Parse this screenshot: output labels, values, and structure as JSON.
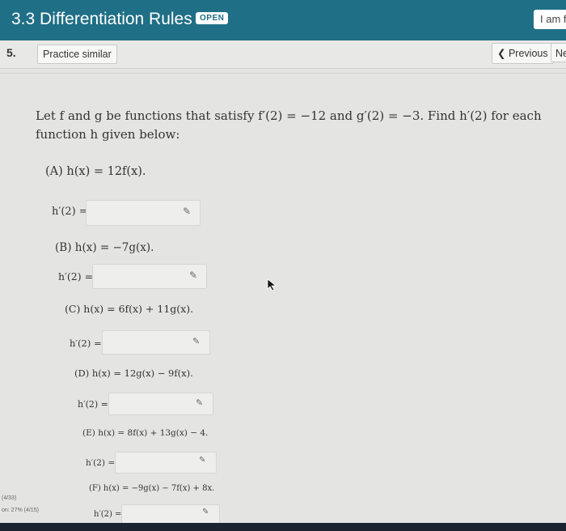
{
  "header": {
    "title": "3.3 Differentiation Rules",
    "badge": "OPEN",
    "right_button": "I am f"
  },
  "toolbar": {
    "question_number": "5.",
    "practice_label": "Practice similar",
    "previous_label": "Previous",
    "next_label": "Ne"
  },
  "question": {
    "text": "Let f and g be functions that satisfy f′(2) = −12 and g′(2) = −3. Find h′(2) for each function h given below:"
  },
  "parts": [
    {
      "label": "(A) h(x) = 12f(x).",
      "answer_label": "h′(2) =",
      "value": ""
    },
    {
      "label": "(B) h(x) = −7g(x).",
      "answer_label": "h′(2) =",
      "value": ""
    },
    {
      "label": "(C) h(x) = 6f(x) + 11g(x).",
      "answer_label": "h′(2) =",
      "value": ""
    },
    {
      "label": "(D) h(x) = 12g(x) − 9f(x).",
      "answer_label": "h′(2) =",
      "value": ""
    },
    {
      "label": "(E) h(x) = 8f(x) + 13g(x) − 4.",
      "answer_label": "h′(2) =",
      "value": ""
    },
    {
      "label": "(F) h(x) = −9g(x) − 7f(x) + 8x.",
      "answer_label": "h′(2) =",
      "value": ""
    }
  ],
  "side_notes": [
    "(4/33)",
    "on: 27% (4/15)"
  ],
  "icons": {
    "pencil": "pencil-icon",
    "previous": "chevron-left-icon",
    "cursor": "mouse-pointer-icon"
  },
  "colors": {
    "header_bg": "#1f6f86",
    "page_bg": "#e4e4e2"
  }
}
